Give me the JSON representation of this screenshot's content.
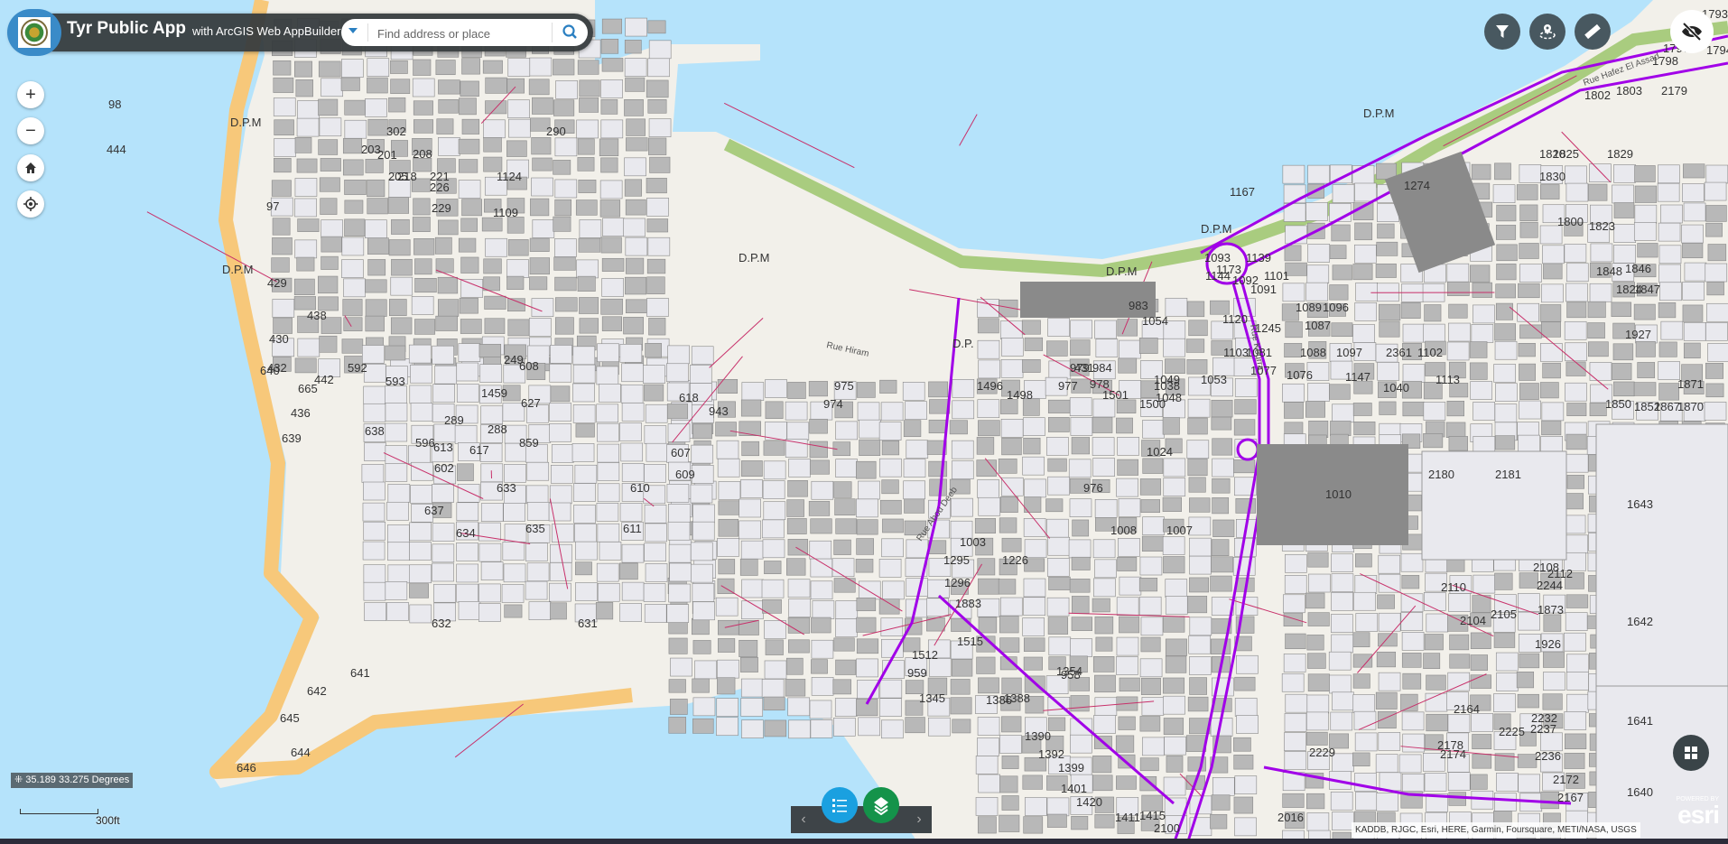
{
  "header": {
    "title": "Tyr Public App",
    "subtitle": "with ArcGIS Web AppBuilder"
  },
  "search": {
    "placeholder": "Find address or place",
    "icon": "search-icon"
  },
  "nav": {
    "zoom_in": "+",
    "zoom_out": "−"
  },
  "toolbar": [
    {
      "name": "filter",
      "icon": "filter-icon"
    },
    {
      "name": "nearby",
      "icon": "location-pin-icon"
    },
    {
      "name": "measure",
      "icon": "ruler-icon"
    }
  ],
  "coordinates": "35.189 33.275 Degrees",
  "scale": "300ft",
  "attribution": "KADDB, RJGC, Esri, HERE, Garmin, Foursquare, METI/NASA, USGS",
  "esri_logo": {
    "powered": "POWERED BY",
    "brand": "esri"
  },
  "colors": {
    "water": "#b5e3fb",
    "land": "#f2f0ea",
    "beach": "#f7c87a",
    "park": "#a9cc7f",
    "parcel": "#e9e9ee",
    "building": "#b8b8b8",
    "main_road": "#a100e8",
    "street": "#c8306a",
    "toolbar_button": "#485860",
    "widget_blue": "#1aa0e0",
    "widget_green": "#14934a"
  },
  "map_labels": [
    "D.P.M",
    "D.P.M",
    "D.P.M",
    "D.P.M",
    "D.P.M",
    "D.P.M",
    "D.P.",
    "640",
    "665",
    "639",
    "638",
    "637",
    "635",
    "634",
    "633",
    "632",
    "631",
    "641",
    "642",
    "645",
    "644",
    "646",
    "610",
    "611",
    "618",
    "607",
    "609",
    "943",
    "974",
    "975",
    "976",
    "1010",
    "2180",
    "2181",
    "1643",
    "1642",
    "1641",
    "1640",
    "1008",
    "1007",
    "1120",
    "1173",
    "1103",
    "1167",
    "1274",
    "1797",
    "1798",
    "1793",
    "1794",
    "1093",
    "1139",
    "1144",
    "1092",
    "1101",
    "1091",
    "1089",
    "1096",
    "1087",
    "1245",
    "1081",
    "1088",
    "1097",
    "1077",
    "1076",
    "1147",
    "2361",
    "1102",
    "1113",
    "1049",
    "1048",
    "1053",
    "983",
    "1054",
    "1024",
    "1003",
    "1226",
    "1295",
    "1296",
    "1883",
    "1515",
    "1512",
    "959",
    "958",
    "1354",
    "1345",
    "1386",
    "1388",
    "1390",
    "1392",
    "1399",
    "1401",
    "1420",
    "1411",
    "1415",
    "2100",
    "2016",
    "2229",
    "2225",
    "2237",
    "2232",
    "2236",
    "2172",
    "2167",
    "2164",
    "2174",
    "2178",
    "2110",
    "2104",
    "2105",
    "2108",
    "2112",
    "2244",
    "1873",
    "1926",
    "1927",
    "1871",
    "1870",
    "1867",
    "1852",
    "1850",
    "1848",
    "1846",
    "1847",
    "1824",
    "1823",
    "1820",
    "1825",
    "1829",
    "1830",
    "1800",
    "1802",
    "1803",
    "2179",
    "1040",
    "1038",
    "1500",
    "1501",
    "1498",
    "1496",
    "984",
    "978",
    "979",
    "977",
    "431",
    "432",
    "430",
    "429",
    "97",
    "98",
    "444",
    "438",
    "436",
    "442",
    "592",
    "593",
    "596",
    "602",
    "613",
    "617",
    "859",
    "627",
    "608",
    "1459",
    "249",
    "288",
    "289",
    "290",
    "302",
    "201",
    "203",
    "205",
    "208",
    "218",
    "221",
    "226",
    "229",
    "1124",
    "1109"
  ],
  "street_labels": [
    "Rue Hiram",
    "Rue Hafez El Assad",
    "Rue Abou Deeb",
    "Rue Kourra"
  ]
}
